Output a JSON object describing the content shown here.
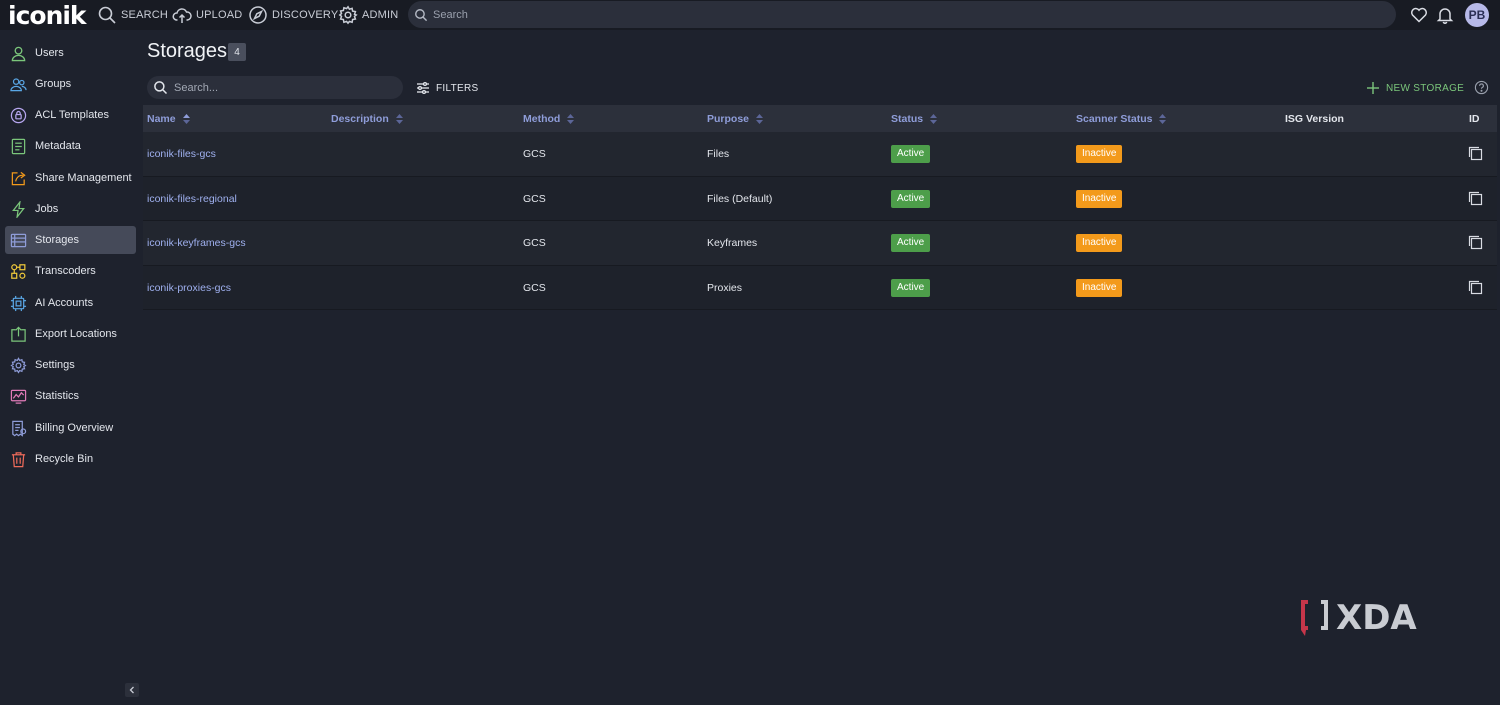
{
  "app": {
    "logo": "iconik"
  },
  "topnav": [
    {
      "label": "SEARCH",
      "icon": "search-icon"
    },
    {
      "label": "UPLOAD",
      "icon": "cloud-upload-icon"
    },
    {
      "label": "DISCOVERY",
      "icon": "compass-icon"
    },
    {
      "label": "ADMIN",
      "icon": "gear-icon"
    }
  ],
  "topsearch": {
    "placeholder": "Search"
  },
  "user": {
    "initials": "PB"
  },
  "sidebar": {
    "items": [
      {
        "label": "Users",
        "icon": "user-icon",
        "color": "#7bc67b"
      },
      {
        "label": "Groups",
        "icon": "group-icon",
        "color": "#5aa7e6"
      },
      {
        "label": "ACL Templates",
        "icon": "lock-icon",
        "color": "#b7a7f0"
      },
      {
        "label": "Metadata",
        "icon": "document-icon",
        "color": "#7bc67b"
      },
      {
        "label": "Share Management",
        "icon": "share-icon",
        "color": "#f39a1b"
      },
      {
        "label": "Jobs",
        "icon": "lightning-icon",
        "color": "#7bc67b"
      },
      {
        "label": "Storages",
        "icon": "storage-icon",
        "color": "#8f9dd9",
        "active": true
      },
      {
        "label": "Transcoders",
        "icon": "transcoder-icon",
        "color": "#f0c93a"
      },
      {
        "label": "AI Accounts",
        "icon": "chip-icon",
        "color": "#5aa7e6"
      },
      {
        "label": "Export Locations",
        "icon": "export-icon",
        "color": "#7bc67b"
      },
      {
        "label": "Settings",
        "icon": "settings-icon",
        "color": "#8f9dd9"
      },
      {
        "label": "Statistics",
        "icon": "statistics-icon",
        "color": "#e07bb8"
      },
      {
        "label": "Billing Overview",
        "icon": "billing-icon",
        "color": "#8f9dd9"
      },
      {
        "label": "Recycle Bin",
        "icon": "trash-icon",
        "color": "#ef6b5a"
      }
    ]
  },
  "page": {
    "title": "Storages",
    "count": "4",
    "search_placeholder": "Search...",
    "filters_label": "FILTERS",
    "new_storage_label": "NEW STORAGE"
  },
  "table": {
    "columns": [
      {
        "label": "Name",
        "sortable": true
      },
      {
        "label": "Description",
        "sortable": true
      },
      {
        "label": "Method",
        "sortable": true
      },
      {
        "label": "Purpose",
        "sortable": true
      },
      {
        "label": "Status",
        "sortable": true
      },
      {
        "label": "Scanner Status",
        "sortable": true
      },
      {
        "label": "ISG Version",
        "sortable": false
      },
      {
        "label": "ID",
        "sortable": false
      }
    ],
    "rows": [
      {
        "name": "iconik-files-gcs",
        "description": "",
        "method": "GCS",
        "purpose": "Files",
        "status": "Active",
        "scanner_status": "Inactive",
        "isg_version": ""
      },
      {
        "name": "iconik-files-regional",
        "description": "",
        "method": "GCS",
        "purpose": "Files (Default)",
        "status": "Active",
        "scanner_status": "Inactive",
        "isg_version": ""
      },
      {
        "name": "iconik-keyframes-gcs",
        "description": "",
        "method": "GCS",
        "purpose": "Keyframes",
        "status": "Active",
        "scanner_status": "Inactive",
        "isg_version": ""
      },
      {
        "name": "iconik-proxies-gcs",
        "description": "",
        "method": "GCS",
        "purpose": "Proxies",
        "status": "Active",
        "scanner_status": "Inactive",
        "isg_version": ""
      }
    ]
  },
  "watermark": {
    "text": "XDA"
  },
  "colors": {
    "background": "#1e222d",
    "link": "#9fb0ef",
    "active_badge": "#4d9e4a",
    "inactive_badge": "#f39a1b",
    "accent_green": "#7bc67b"
  }
}
